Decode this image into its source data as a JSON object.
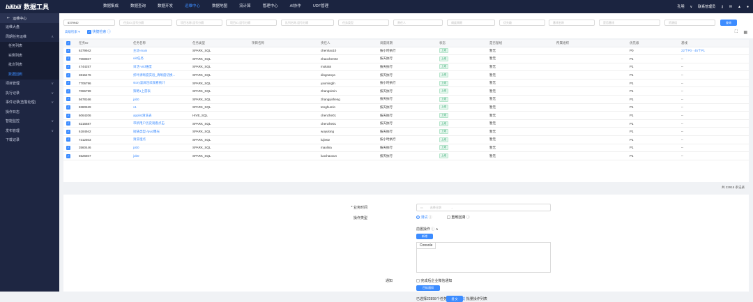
{
  "header": {
    "logo": "bilibili",
    "app_title": "数据工具",
    "nav": [
      "数据集成",
      "数据查询",
      "数据开发",
      "运维中心",
      "数据地图",
      "流计算",
      "管理中心",
      "AI协作",
      "UDF管理"
    ],
    "active_nav": "运维中心",
    "user": "孔明",
    "role": "联系管理员"
  },
  "sidebar": {
    "head": "运维中心",
    "items": [
      {
        "label": "运维大盘",
        "type": "item"
      },
      {
        "label": "周期任务运维",
        "type": "group"
      },
      {
        "label": "任务列表",
        "type": "sub"
      },
      {
        "label": "实例列表",
        "type": "sub"
      },
      {
        "label": "批次列表",
        "type": "sub"
      },
      {
        "label": "数据回刷",
        "type": "sub-active"
      },
      {
        "label": "项目管理",
        "type": "group"
      },
      {
        "label": "执行记录",
        "type": "group"
      },
      {
        "label": "事件记录(告警处理)",
        "type": "group"
      },
      {
        "label": "操作日志",
        "type": "item"
      },
      {
        "label": "智能监控",
        "type": "group"
      },
      {
        "label": "发布管理",
        "type": "group"
      },
      {
        "label": "下载记录",
        "type": "item"
      }
    ]
  },
  "filters": {
    "task_id_value": "6379942",
    "placeholders": [
      "任务ID,逗号分隔",
      "项目名称,逗号分隔",
      "项目ID,逗号分隔",
      "队列名称,逗号分隔",
      "任务类型",
      "责任人",
      "调度周期",
      "优先级",
      "基线名称",
      "是否基线",
      "资源组"
    ],
    "search_label": "查询",
    "advanced": "高级检索",
    "quick_search": "快捷检索"
  },
  "table": {
    "columns": [
      "任务ID",
      "任务名称",
      "任务类型",
      "项目名称",
      "责任人",
      "调度周期",
      "状态",
      "是否基线",
      "所属组织",
      "优先级",
      "基线"
    ],
    "rows": [
      {
        "id": "6379942",
        "name": "主动-main",
        "type": "SPARK_SQL",
        "owner": "chenhao10",
        "cycle": "按小时执行",
        "status": "上线",
        "baseline": "暂无",
        "prio": "P0",
        "line": "22个P0  ·  45个P1"
      },
      {
        "id": "7069607",
        "name": "uld任务",
        "type": "SPARK_SQL",
        "owner": "zhaochen03",
        "cycle": "按天执行",
        "status": "上线",
        "baseline": "暂无",
        "prio": "P1",
        "line": "--"
      },
      {
        "id": "4744257",
        "name": "日活-vrid维度",
        "type": "SPARK_SQL",
        "owner": "mokaixi",
        "cycle": "按天执行",
        "status": "上线",
        "baseline": "暂无",
        "prio": "P1",
        "line": "--"
      },
      {
        "id": "3815476",
        "name": "折叶清晰度实验_清晰度切换...",
        "type": "SPARK_SQL",
        "owner": "dingnanya",
        "cycle": "按天执行",
        "status": "上线",
        "baseline": "暂无",
        "prio": "P1",
        "line": "--"
      },
      {
        "id": "7706796",
        "name": "story竖屏连续观看统计",
        "type": "SPARK_SQL",
        "owner": "yaomingfn",
        "cycle": "按小时执行",
        "status": "上线",
        "baseline": "暂无",
        "prio": "P1",
        "line": "--"
      },
      {
        "id": "7066799",
        "name": "策略1上游表",
        "type": "SPARK_SQL",
        "owner": "zhangsimin",
        "cycle": "按天执行",
        "status": "上线",
        "baseline": "暂无",
        "prio": "P1",
        "line": "--"
      },
      {
        "id": "5678166",
        "name": "job0",
        "type": "SPARK_SQL",
        "owner": "zhangyisheng",
        "cycle": "按天执行",
        "status": "上线",
        "baseline": "暂无",
        "prio": "P1",
        "line": "--"
      },
      {
        "id": "8380529",
        "name": "v1",
        "type": "SPARK_SQL",
        "owner": "tenghumin",
        "cycle": "按天执行",
        "status": "上线",
        "baseline": "暂无",
        "prio": "P1",
        "line": "--"
      },
      {
        "id": "6064206",
        "name": "applist清洗表",
        "type": "HIVE_SQL",
        "owner": "chenzhe01",
        "cycle": "按天执行",
        "status": "上线",
        "baseline": "暂无",
        "prio": "P1",
        "line": "--"
      },
      {
        "id": "8216687",
        "name": "带新用户历史观看点击",
        "type": "SPARK_SQL",
        "owner": "chenzhe01",
        "cycle": "按天执行",
        "status": "上线",
        "baseline": "暂无",
        "prio": "P1",
        "line": "--"
      },
      {
        "id": "6184942",
        "name": "短链类型-/pvid曝光",
        "type": "SPARK_SQL",
        "owner": "wuyulong",
        "cycle": "按天执行",
        "status": "上线",
        "baseline": "暂无",
        "prio": "P1",
        "line": "--"
      },
      {
        "id": "7312503",
        "name": "清洗埋点",
        "type": "SPARK_SQL",
        "owner": "lujie02",
        "cycle": "按小时执行",
        "status": "上线",
        "baseline": "暂无",
        "prio": "P1",
        "line": "--"
      },
      {
        "id": "3560446",
        "name": "job0",
        "type": "SPARK_SQL",
        "owner": "maolina",
        "cycle": "按天执行",
        "status": "上线",
        "baseline": "暂无",
        "prio": "P1",
        "line": "--"
      },
      {
        "id": "5526607",
        "name": "job0",
        "type": "SPARK_SQL",
        "owner": "luochaoxun",
        "cycle": "按天执行",
        "status": "上线",
        "baseline": "暂无",
        "prio": "P1",
        "line": "--"
      }
    ],
    "total": "共 22915 条记录"
  },
  "form": {
    "biz_time_label": "* 业务时间",
    "date_placeholder": "选择日期",
    "op_type_label": "操作类型",
    "op_test": "测试",
    "op_rollback": "重刷回溯",
    "pre_op_label": "前置操作",
    "pre_op_btn": "新增",
    "console_tab": "Console",
    "notify_label": "通知",
    "notify_text": "完成后企业微信通知",
    "notify_btn": "目标通知",
    "summary_prefix": "已选择22858个任务，点击",
    "summary_link": "下载",
    "summary_suffix": "批量操作列表",
    "submit": "提 交"
  }
}
